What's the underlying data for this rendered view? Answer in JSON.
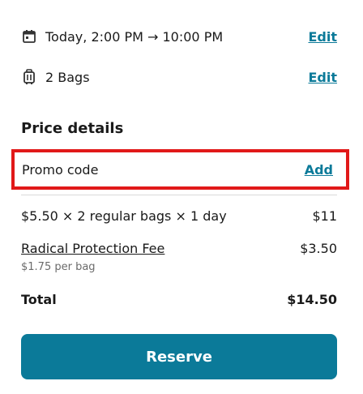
{
  "booking": {
    "time": {
      "icon": "calendar-icon",
      "text": "Today, 2:00 PM → 10:00 PM",
      "edit_label": "Edit"
    },
    "bags": {
      "icon": "luggage-icon",
      "text": "2 Bags",
      "edit_label": "Edit"
    }
  },
  "price_details": {
    "heading": "Price details",
    "promo": {
      "label": "Promo code",
      "add_label": "Add"
    },
    "line_items": [
      {
        "label": "$5.50 × 2 regular bags × 1 day",
        "amount": "$11"
      },
      {
        "label": "Radical Protection Fee",
        "amount": "$3.50",
        "note": "$1.75 per bag"
      }
    ],
    "total": {
      "label": "Total",
      "amount": "$14.50"
    }
  },
  "actions": {
    "reserve_label": "Reserve"
  },
  "colors": {
    "accent": "#0b7a99",
    "highlight": "#e11919"
  }
}
